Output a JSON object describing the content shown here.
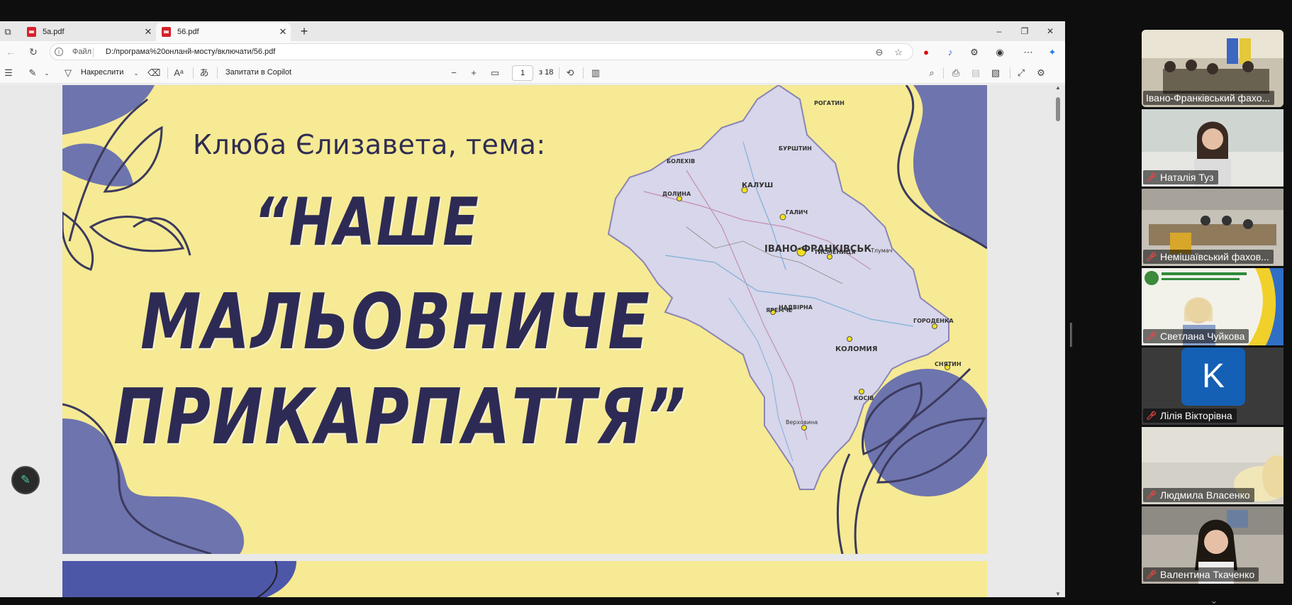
{
  "browser": {
    "tabs": [
      {
        "label": "5a.pdf",
        "active": false
      },
      {
        "label": "56.pdf",
        "active": true
      }
    ],
    "address": {
      "scheme_label": "Файл",
      "url": "D:/програма%20онланй-мосту/включати/56.pdf"
    },
    "window_controls": {
      "minimize": "–",
      "restore": "❐",
      "close": "✕"
    }
  },
  "pdf_toolbar": {
    "draw_label": "Накреслити",
    "copilot_label": "Запитати в Copilot",
    "page_current": "1",
    "page_total_label": "з 18",
    "zoom_out": "−",
    "zoom_in": "+"
  },
  "slide": {
    "subtitle": "Клюба Єлизавета, тема:",
    "title_line1": "“НАШЕ",
    "title_line2": "МАЛЬОВНИЧЕ",
    "title_line3": "ПРИКАРПАТТЯ”",
    "map_cities": [
      "РОГАТИН",
      "ГАЛИЧ",
      "КАЛУШ",
      "БОЛЕХІВ",
      "ДОЛИНА",
      "ІВАНО-ФРАНКІВСЬК",
      "ТИСМЕНИЦЯ",
      "НАДВІРНА",
      "КОЛОМИЯ",
      "ГОРОДЕНКА",
      "СНЯТИН",
      "КОСІВ",
      "ЯРЕМЧЕ",
      "Верховина",
      "БУРШТИН",
      "Тлумач"
    ],
    "colors": {
      "background": "#f6ea94",
      "accent": "#6e74ad",
      "title": "#2d2b55"
    }
  },
  "video_panel": {
    "participants": [
      {
        "name": "Івано-Франківський фахо...",
        "muted": false,
        "speaking": true
      },
      {
        "name": "Наталія Туз",
        "muted": true
      },
      {
        "name": "Немішаївський фахов...",
        "muted": true
      },
      {
        "name": "Светлана Чуйкова",
        "muted": true
      },
      {
        "name": "Лілія Вікторівна",
        "muted": true,
        "avatar_letter": "K"
      },
      {
        "name": "Людмила Власенко",
        "muted": true
      },
      {
        "name": "Валентина Ткаченко",
        "muted": true
      }
    ]
  }
}
